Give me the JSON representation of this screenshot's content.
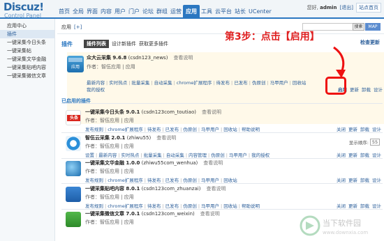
{
  "logo": {
    "title": "Discuz!",
    "subtitle": "Control Panel"
  },
  "nav": [
    "首页",
    "全局",
    "界面",
    "内容",
    "用户",
    "门户",
    "论坛",
    "群组",
    "运营",
    "应用",
    "工具",
    "云平台",
    "站长",
    "UCenter"
  ],
  "nav_active_index": 9,
  "user": {
    "greeting": "您好,",
    "name": "admin",
    "logout": "[退出]",
    "site_home": "站点首页"
  },
  "breadcrumb": {
    "text": "应用",
    "plus": "[+]"
  },
  "search": {
    "placeholder": "",
    "button": "搜索",
    "map": "MAP"
  },
  "sidebar": {
    "items": [
      "应用中心",
      "插件",
      "一键采集今日头条",
      "一键采集帖",
      "一键采集文华金融",
      "一键采集贴吧内容",
      "一键采集微信文章"
    ],
    "active_index": 1
  },
  "tabs": {
    "title": "插件",
    "items": [
      "插件列表",
      "设计新插件",
      "获取更多插件"
    ],
    "active_index": 0
  },
  "new_plugin_link": "检查更新",
  "annotation": "第3步：点击【启用】",
  "highlighted_plugin": {
    "name": "众大云采集 9.6.8",
    "id": "(csdn123_news)",
    "doc": "查看说明",
    "author": "作者：智伍应用 | 应用",
    "links_row1": [
      "最新内容",
      "实时热点",
      "批量采集",
      "自动采集",
      "chrome扩展程序",
      "待发布",
      "已发布",
      "伪原创",
      "马甲用户",
      "回收站"
    ],
    "links_row2": [
      "我的授权"
    ],
    "actions": [
      "启用",
      "更新",
      "卸载",
      "设计"
    ],
    "icon_label": "众大云采集"
  },
  "enabled_header": "已启用的插件",
  "plugins": [
    {
      "name": "一键采集今日头条 9.0.1",
      "id": "(csdn123com_toutiao)",
      "doc": "查看说明",
      "author": "作者：智伍应用 | 应用",
      "links": [
        "发布规则",
        "chrome扩展程序",
        "待发布",
        "已发布",
        "伪原创",
        "马甲用户",
        "回收站",
        "帮助说明"
      ],
      "actions": [
        "关闭",
        "更新",
        "卸载",
        "设计"
      ],
      "icon": "toutiao-icon",
      "icon_text": "头条"
    },
    {
      "name": "智伍云采集 2.0.1",
      "id": "(zhiwu55)",
      "doc": "查看说明",
      "author": "作者：智伍应用 | 应用",
      "links": [
        "设置",
        "最新内容",
        "实时热点",
        "批量采集",
        "自动采集",
        "内容管理",
        "伪原创",
        "马甲用户",
        "我的授权"
      ],
      "actions": [
        "关闭",
        "更新",
        "卸载",
        "设计"
      ],
      "icon": "zhiwu-icon",
      "order_label": "显示顺序:",
      "order_value": "55"
    },
    {
      "name": "一键采集文华金融 1.0.0",
      "id": "(zhiwu55com_wenhua)",
      "doc": "查看说明",
      "author": "作者：智伍应用 | 应用",
      "links": [
        "发布规则",
        "chrome扩展程序",
        "待发布",
        "已发布",
        "伪原创",
        "马甲用户",
        "回收站"
      ],
      "actions": [
        "关闭",
        "更新",
        "卸载",
        "设计"
      ],
      "icon": "wenhua-icon"
    },
    {
      "name": "一键采集贴吧内容 8.0.1",
      "id": "(csdn123com_zhuanzai)",
      "doc": "查看说明",
      "author": "作者：智伍应用 | 应用",
      "links": [
        "发布规则",
        "chrome扩展程序",
        "待发布",
        "已发布",
        "伪原创",
        "马甲用户",
        "回收站",
        "帮助说明"
      ],
      "actions": [
        "关闭",
        "更新",
        "卸载",
        "设计"
      ],
      "icon": "tieba-icon"
    },
    {
      "name": "一键采集微信文章 7.0.1",
      "id": "(csdn123com_weixin)",
      "doc": "查看说明",
      "author": "作者：智伍应用 | 应用",
      "links": [],
      "actions": [],
      "icon": "weixin-icon"
    }
  ],
  "watermark": {
    "text": "当下软件园",
    "url": "www.downxia.com"
  }
}
